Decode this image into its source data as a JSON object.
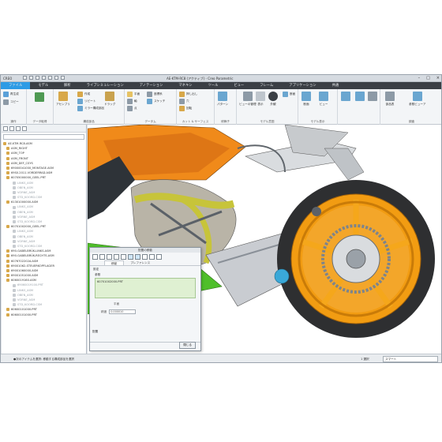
{
  "app": {
    "logo": "CREO",
    "title": "AE-KTM-RC8 (アクティブ) - Creo Parametric"
  },
  "tabs": [
    "ファイル",
    "モデル",
    "解析",
    "ライブシミュレーション",
    "アノテーション",
    "マネキン",
    "ツール",
    "ビュー",
    "フレーム",
    "アプリケーション",
    "共通"
  ],
  "ribbon": {
    "groups": [
      {
        "label": "操作",
        "buttons": [
          "再生成",
          "コピー"
        ]
      },
      {
        "label": "データ取得",
        "buttons": [
          "ユーザー定義フィーチャー"
        ]
      },
      {
        "label": "構成部品",
        "buttons": [
          "アセンブリ",
          "作成",
          "リピート",
          "ミラー構成部品",
          "構成部品",
          "ドラッグ"
        ]
      },
      {
        "label": "データム",
        "buttons": [
          "平面",
          "軸",
          "点",
          "座標系",
          "スケッチ"
        ]
      },
      {
        "label": "カット & サーフェス",
        "buttons": [
          "押し出し",
          "穴",
          "回転"
        ]
      },
      {
        "label": "修飾子",
        "buttons": [
          "パターン"
        ]
      },
      {
        "label": "モデル意図",
        "buttons": [
          "ビューの管理",
          "表示",
          "外観",
          "断面"
        ]
      },
      {
        "label": "モデル表示",
        "buttons": [
          "断面",
          "ビュー"
        ]
      },
      {
        "label": "",
        "buttons": [
          "流体ソルバー",
          "マルチボディ"
        ]
      },
      {
        "label": "",
        "buttons": [
          "コンポーネントインターフェース",
          "パブリッシュジオメトリ"
        ]
      },
      {
        "label": "調査",
        "buttons": [
          "部品表",
          "参照ビューア"
        ]
      }
    ]
  },
  "tree": {
    "items": [
      {
        "label": "AE-KTM-RC8.ASM",
        "dim": false
      },
      {
        "label": "ASM_RIGHT",
        "dim": false
      },
      {
        "label": "ASM_TOP",
        "dim": false
      },
      {
        "label": "ASM_FRONT",
        "dim": false
      },
      {
        "label": "ASM_DEF_CSYS",
        "dim": false
      },
      {
        "label": "69000041000_MONTAGE.ASM",
        "dim": false
      },
      {
        "label": "69S0.2011.VORDERRAD.ASM",
        "dim": false
      },
      {
        "label": "60705000000_GEEL.PRT",
        "dim": false
      },
      {
        "label": "LINKS_ASM",
        "dim": true
      },
      {
        "label": "OBEN_ASM",
        "dim": true
      },
      {
        "label": "VORNE_ASM",
        "dim": true
      },
      {
        "label": "STD_KOORD.CSM",
        "dim": true
      },
      {
        "label": "61301000000.ASM",
        "dim": false
      },
      {
        "label": "LINKS_ASM",
        "dim": true
      },
      {
        "label": "OBEN_ASM",
        "dim": true
      },
      {
        "label": "VORNE_ASM",
        "dim": true
      },
      {
        "label": "STD_KOORD.CSM",
        "dim": true
      },
      {
        "label": "60701002000_GEEL.PRT",
        "dim": false
      },
      {
        "label": "LINKS_ASM",
        "dim": true
      },
      {
        "label": "OBEN_ASM",
        "dim": true
      },
      {
        "label": "VORNE_ASM",
        "dim": true
      },
      {
        "label": "STD_KOORD.CSM",
        "dim": true
      },
      {
        "label": "690-GABELBRÜK-LINKS.ASM",
        "dim": false
      },
      {
        "label": "690-GABELBRÜK-RECHTS.ASM",
        "dim": false
      },
      {
        "label": "6076702202A.ASM",
        "dim": false
      },
      {
        "label": "69001062-STEUERKOPFLAGER",
        "dim": false
      },
      {
        "label": "69001060000.ASM",
        "dim": false
      },
      {
        "label": "69001051000.ASM",
        "dim": false
      },
      {
        "label": "6060019160.ASM",
        "dim": false
      },
      {
        "label": "69060019100.PRT",
        "dim": true
      },
      {
        "label": "LINKS_ASM",
        "dim": true
      },
      {
        "label": "OBEN_ASM",
        "dim": true
      },
      {
        "label": "VORNE_ASM",
        "dim": true
      },
      {
        "label": "STD_KOORD.CSM",
        "dim": true
      },
      {
        "label": "60600101000.PRT",
        "dim": false
      },
      {
        "label": "60600101000.PRT",
        "dim": false
      }
    ]
  },
  "dialog": {
    "title": "配置の移動",
    "tabs": [
      "移動",
      "プレファレンス"
    ],
    "section": "設定",
    "ref_label": "参照",
    "ref_value": "60701002000.PRT",
    "row1": "平面",
    "row2_label": "精度",
    "row2_value": "0.000010",
    "props": "配置",
    "cancel": "閉じる"
  },
  "status": {
    "message": "●次のアイテムを選択: 移動する構成部品を選択",
    "sel": "1 選択",
    "filter": "スマート"
  }
}
